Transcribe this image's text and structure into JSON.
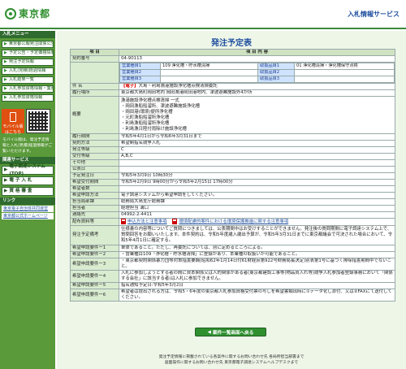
{
  "header": {
    "logo_text": "東京都",
    "service_title": "入札情報サービス"
  },
  "sidebar": {
    "section_menu": "入札メニュー",
    "items": [
      "東京都公報発注関係公告",
      "予定公告・予定価格情報",
      "発注予定情報",
      "入札(見積)経過情報",
      "入札結果一覧",
      "入札参加資格情報・業務",
      "入札参加資格情報"
    ],
    "mobile_label": "モバイル版はこちら",
    "mobile_note": "モバイル版は、発注予定情報と入札(見積)経過情報がご覧いただけます。",
    "section_other": "関連サービス",
    "buttons": [
      "電子調達システム(TOP)",
      "電 子 入 札",
      "資 格 審 査"
    ],
    "section_links": "リンク",
    "links": [
      "東京電子自治体共同運営",
      "東京都公式ホームページ"
    ]
  },
  "main": {
    "page_title": "発注予定表",
    "col_item": "項 目",
    "col_content": "項 目 内 容",
    "rows": {
      "contract_no": {
        "label": "契約番号",
        "value": "04-90113"
      },
      "category": {
        "label": "件 名"
      },
      "period": {
        "label": "履行場所",
        "value": "東京都大島町岡田地内 岡田漁港岡田港地内、津波避難施設外4か所"
      },
      "overview": {
        "label": "概要",
        "lines": [
          "漁港施設浄化槽点検清掃 一式",
          "・岡田漁船船溜所、津波避難施設浄化槽",
          "・岡田港(環境)便所浄化槽",
          "・元町漁船船溜所浄化槽",
          "・利島漁船船溜所浄化槽",
          "・利島漁日陸付雨除け施設浄化槽"
        ]
      },
      "term": {
        "label": "履行期間",
        "value": "令和5年4月1日から令和6年3月31日まで"
      },
      "contract_method": {
        "label": "契約方法",
        "value": "希望制指名競争入札"
      },
      "form": {
        "label": "発注等級",
        "value": "C"
      },
      "grade": {
        "label": "受付等級",
        "value": "A,B,C"
      },
      "other": {
        "label": "その他",
        "value": ""
      },
      "announce_date": {
        "label": "公表日",
        "value": ""
      },
      "schedule": {
        "label": "予定発注日",
        "value": "令和5年3月9日 10時30分"
      },
      "period2": {
        "label": "希望受付期間",
        "value": "令和5年2月9日 9時00分から令和5年2月15日 17時00分"
      },
      "pq": {
        "label": "希望者数",
        "value": ""
      },
      "method": {
        "label": "希望申請方法",
        "value": "電子調達システムから希望申請をしてください。"
      },
      "office": {
        "label": "担当局部課",
        "value": "総務局大島支庁総務課"
      },
      "person": {
        "label": "担当者",
        "value": "経理担当 溝口"
      },
      "tel": {
        "label": "連絡先",
        "value": "04992-2-4411"
      },
      "docs": {
        "label": "配布資料等"
      },
      "note": {
        "label": "発注予定備考",
        "value": "仕様書の内容等についてご質問につきましては、公表期間中はお受けすることができません。発注後の質問期間に電子調達システム上で、質問回答をお願いいたします。本件契約は、令和5年度歳入歳出予算が、令和5年3月31日までに東京都議会で可決された場合において、令和5年4月1日に確定する。"
      }
    },
    "inner": {
      "k1": "営業種目1",
      "v1": "109 浄化槽・貯水槽清掃",
      "k2": "取扱品目1",
      "v2": "01 浄化槽清掃・浄化槽保守点検",
      "k3": "営業種目2",
      "v3": "",
      "k4": "取扱品目2",
      "v4": "",
      "k5": "営業種目3",
      "v5": "",
      "k6": "取扱品目3",
      "v6": ""
    },
    "title_prefix": "【電子】",
    "title_value": "大島・利島漁港施設浄化槽点検清掃委託",
    "doc_link1": "申込方法と注意事項",
    "doc_link2": "環境配慮的案件における環境保護推進に関する注意事項",
    "requirements": [
      {
        "label": "希望申請要件ー1",
        "value": "単体であること。ただし、再委託については、別に定めるところによる。"
      },
      {
        "label": "希望申請要件ー2",
        "value": "・営業種目109「浄化槽・貯水槽清掃」に登録があり、本業種の取扱いが可能であること。"
      },
      {
        "label": "希望申請要件ー3",
        "value": "・東京都契約関係暴力団等対策措置要綱(昭和62年1月14日付61財経庶第922号財務局長決定)別表第1号に基づく排除措置期間中でないこと。"
      },
      {
        "label": "希望申請要件ー4",
        "value": "入札に参加しようとする者の間に資本関係又は人的関係がある者(東京都建設工事等(物品買入れ等)競争入札参加者登録事務において「関係する会社」に該当する者)は入札に参加できません。"
      },
      {
        "label": "希望申請要件ー5",
        "value": "指名通知予定日:令和5年3月2日"
      },
      {
        "label": "希望申請要件ー6",
        "value": "希望者は提出される方は、令和5・6年度の東京都入札参加資格受付票の写しを希望書類出時に①データ化し添付、又は②FAXにて送付してください。"
      }
    ],
    "back_button": "案件一覧画面へ戻る"
  },
  "footer": {
    "line1": "発注予定情報に掲載されている各案件に関するお問い合わせ先 各局所担当部署まで",
    "line2": "画面操作に関するお問い合わせ先 東京都電子調達システムヘルプデスクまで"
  },
  "colors": {
    "brand_green": "#2f8f2f",
    "sidebar_green": "#5a9a3a",
    "title_blue": "#1f4f9f",
    "emphasis_red": "#dd0000"
  }
}
